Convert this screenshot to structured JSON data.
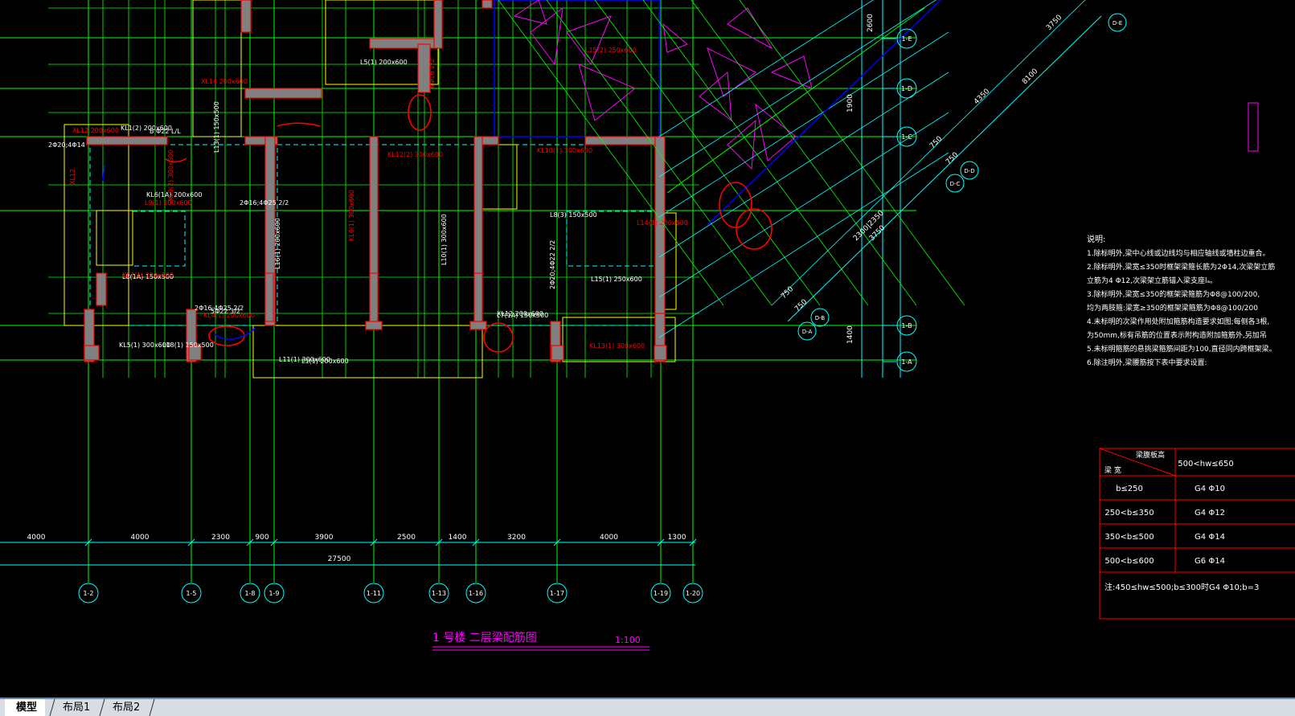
{
  "drawing": {
    "title": "1 号楼    二层梁配筋图",
    "scale": "1:100",
    "total_dim": "27500",
    "bottom_dims": [
      "4000",
      "4000",
      "2300",
      "900",
      "3900",
      "2500",
      "1400",
      "3200",
      "4000",
      "1300"
    ],
    "axis_bubbles": [
      "1-2",
      "1-5",
      "1-8",
      "1-9",
      "1-11",
      "1-13",
      "1-16",
      "1-17",
      "1-19",
      "1-20"
    ],
    "right_bubbles": [
      "1-E",
      "1-D",
      "1-C",
      "1-B",
      "1-A"
    ],
    "diag_bubbles": [
      "D-E",
      "D-D",
      "D-C",
      "D-B",
      "D-A"
    ],
    "right_dims": [
      "2600",
      "1900",
      "1400"
    ],
    "diag_dims": [
      "3750",
      "8100",
      "4350",
      "750",
      "750",
      "2300|2350",
      "3750",
      "750",
      "750"
    ]
  },
  "notes": {
    "heading": "说明:",
    "lines": [
      "1.除标明外,梁中心线或边线均与相应轴线或墙柱边重合。",
      "2.除标明外,梁宽≤350时框架梁箍长筋为2Φ14,次梁架立筋",
      "   立筋为4 Φ12,次梁架立筋锚入梁支座lₐ。",
      "3.除标明外,梁宽≤350的框架梁箍筋为Φ8@100/200,",
      "   均为两肢箍:梁宽≥350的框架梁箍筋为Φ8@100/200",
      "4.未标明的次梁作用处附加箍筋构造要求如图;每侧各3根,",
      "   为50mm,标有吊筋的位置表示附构造附加箍筋外,另加吊",
      "5.未标明箍筋的悬挑梁箍筋间距为100,直径同内跨框架梁。",
      "6.除注明外,梁腰筋按下表中要求设置:"
    ]
  },
  "table": {
    "header_diag_top": "梁腹板高",
    "header_diag_bottom": "梁 宽",
    "header_col": "500<hw≤650",
    "rows": [
      {
        "width": "b≤250",
        "value": "G4 Φ10"
      },
      {
        "width": "250<b≤350",
        "value": "G4 Φ12"
      },
      {
        "width": "350<b≤500",
        "value": "G4 Φ14"
      },
      {
        "width": "500<b≤600",
        "value": "G6 Φ14"
      }
    ],
    "footnote": "注:450≤hw≤500;b≤300时G4 Φ10;b=3"
  },
  "beam_labels": [
    "KL1(2) 200x600",
    "XL12 200x600",
    "2Φ20;4Φ14",
    "B Φ22 L/L",
    "KL6(1A) 200x600",
    "KL12(2) 300x600",
    "L9(1) 200x600",
    "2Φ16;4Φ25 2/2",
    "L13(1) 150x500",
    "KL6(1) 300x600",
    "L10(1) 300x600",
    "L16(1) 200x600",
    "L1(1) 200x600",
    "KL10(1) 300x600",
    "KL13(1) 300x600",
    "L8(1A) 150x500",
    "L14(1) 200x600",
    "XL12",
    "XL14 200x600",
    "L5(1) 200x600",
    "L15(2) 250x600",
    "KL9(2) 300x600",
    "L11(1) 300x600",
    "KL4(1) 200x600",
    "KL5(1) 300x600",
    "XL12 200x600",
    "2Φ20;4Φ22 2/2",
    "KL7(1) 200x600",
    "L18(1) 150x500",
    "L7(1A) 150x500",
    "5Φ22 3/2",
    "2Φ16;4Φ25 2/2",
    "4Φ16 2/2",
    "L15(1) 250x600",
    "L8(3) 150x500"
  ],
  "tabs": [
    "模型",
    "布局1",
    "布局2"
  ],
  "active_tab": "模型",
  "colors": {
    "background": "#000000",
    "axis": "#00ff00",
    "dimension": "#00ffff",
    "wall": "#ffff00",
    "column": "#808080",
    "beam_text": "#ffffff",
    "red_text": "#ff0000",
    "magenta": "#ff00ff",
    "blue": "#0000ff",
    "tab_bar": "#d8dde3"
  }
}
